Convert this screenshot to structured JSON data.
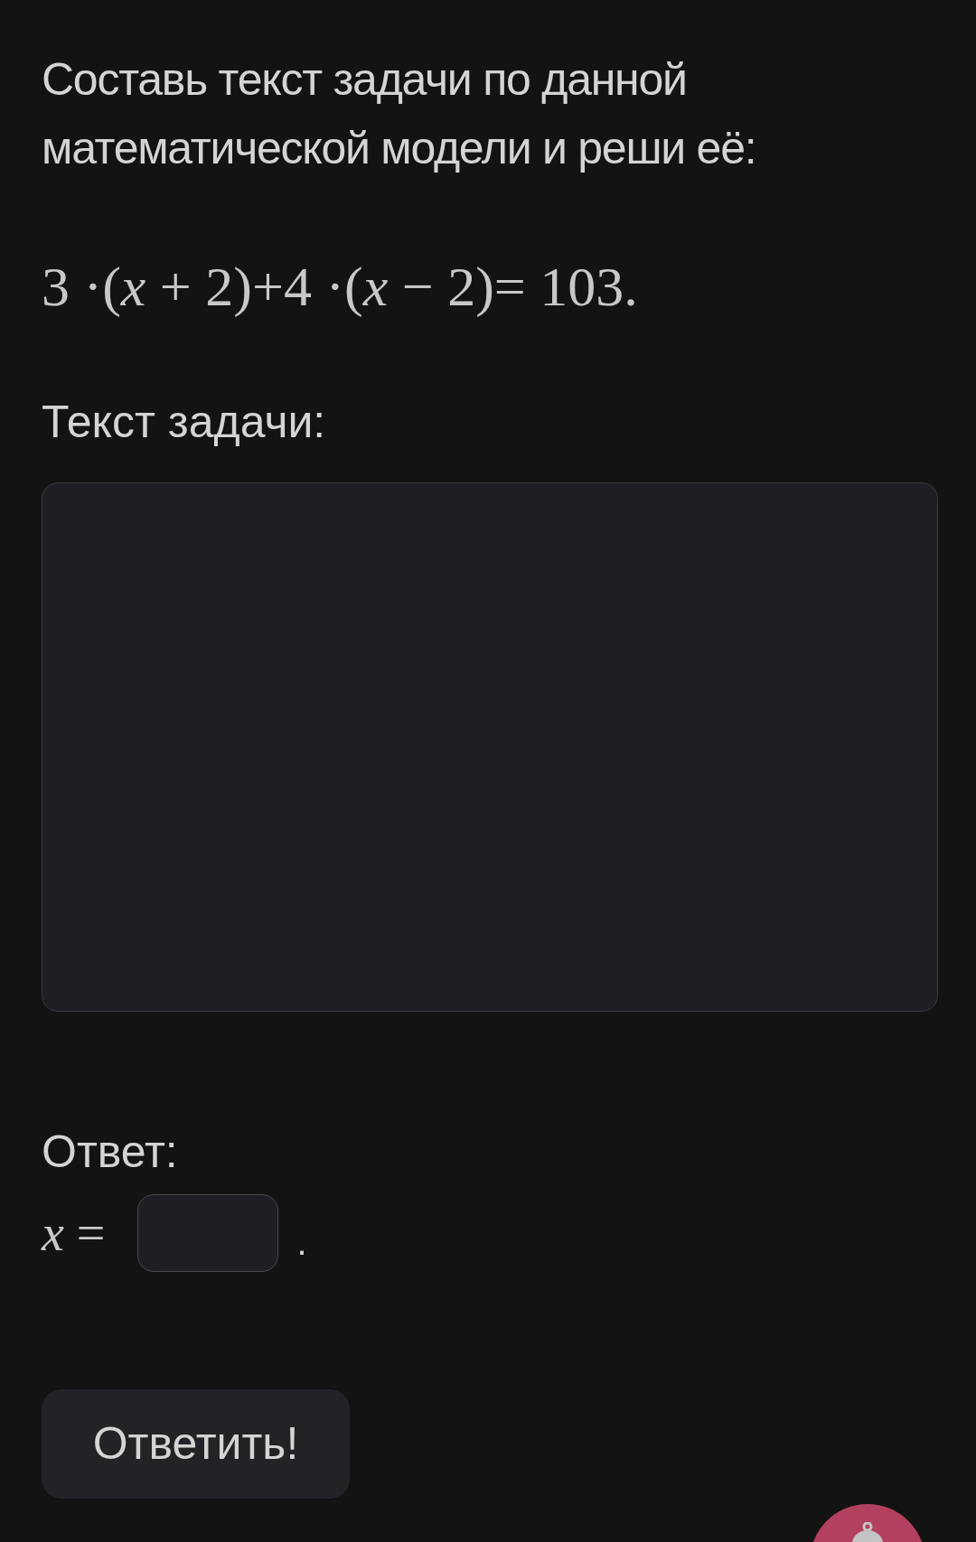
{
  "task": {
    "prompt": "Составь текст задачи по данной математической модели и реши её:",
    "formula": "3 ·(*x* + 2)+4 ·(*x* − 2)= 103."
  },
  "problem_text": {
    "label": "Текст задачи:"
  },
  "answer": {
    "label": "Ответ:",
    "prefix": "*x* =",
    "suffix": "."
  },
  "submit_button": "Ответить!"
}
